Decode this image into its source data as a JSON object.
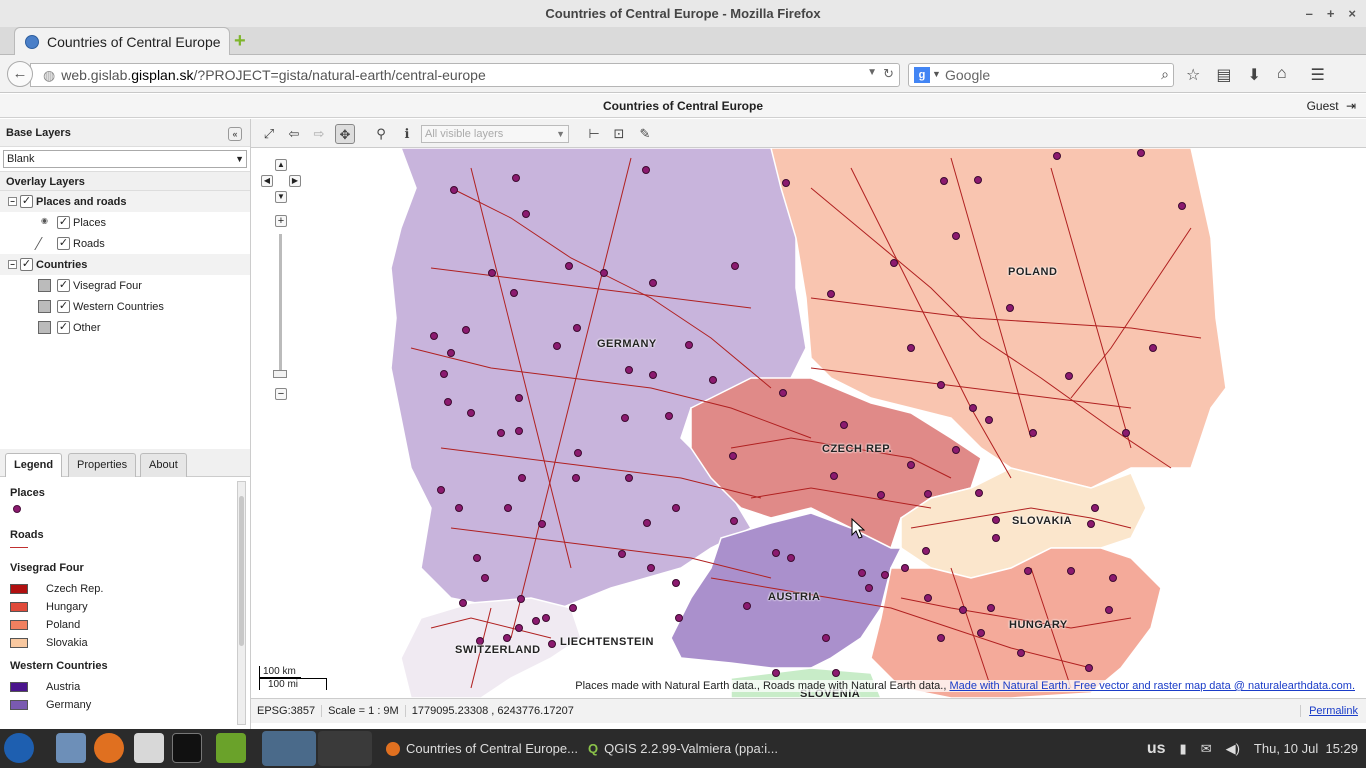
{
  "window": {
    "title": "Countries of Central Europe - Mozilla Firefox",
    "controls": [
      "–",
      "+",
      "×"
    ]
  },
  "tab": {
    "label": "Countries of Central Europe",
    "new_tab": "+"
  },
  "nav": {
    "url_prefix": "web.gislab.",
    "url_host": "gisplan.sk",
    "url_path": "/?PROJECT=gista/natural-earth/central-europe",
    "search_engine": "g",
    "search_placeholder": "Google"
  },
  "app": {
    "title": "Countries of Central Europe",
    "user": "Guest"
  },
  "left_panel": {
    "base_layers_title": "Base Layers",
    "base_layer_selected": "Blank",
    "overlay_title": "Overlay Layers",
    "groups": [
      {
        "label": "Places and roads",
        "children": [
          "Places",
          "Roads"
        ]
      },
      {
        "label": "Countries",
        "children": [
          "Visegrad Four",
          "Western Countries",
          "Other"
        ]
      }
    ]
  },
  "legend_tabs": [
    "Legend",
    "Properties",
    "About"
  ],
  "legend": {
    "places": "Places",
    "roads": "Roads",
    "visegrad_title": "Visegrad Four",
    "visegrad": [
      {
        "name": "Czech Rep.",
        "color": "#b01010"
      },
      {
        "name": "Hungary",
        "color": "#e04a3a"
      },
      {
        "name": "Poland",
        "color": "#f08060"
      },
      {
        "name": "Slovakia",
        "color": "#f8c8a0"
      }
    ],
    "western_title": "Western Countries",
    "western": [
      {
        "name": "Austria",
        "color": "#4a148c"
      },
      {
        "name": "Germany",
        "color": "#7a5ab0"
      }
    ]
  },
  "toolbar": {
    "layer_select": "All visible layers"
  },
  "map": {
    "labels": {
      "germany": "GERMANY",
      "poland": "POLAND",
      "czech": "CZECH REP.",
      "slovakia": "SLOVAKIA",
      "austria": "AUSTRIA",
      "hungary": "HUNGARY",
      "switzerland": "SWITZERLAND",
      "liechtenstein": "LIECHTENSTEIN",
      "slovenia": "SLOVENIA"
    },
    "scale_km": "100 km",
    "scale_mi": "100 mi",
    "attribution_plain": "Places made with Natural Earth data., Roads made with Natural Earth data.,",
    "attribution_link": "Made with Natural Earth. Free vector and raster map data @ naturalearthdata.com."
  },
  "status": {
    "crs": "EPSG:3857",
    "scale": "Scale = 1 : 9M",
    "coords": "1779095.23308 , 6243776.17207",
    "permalink": "Permalink"
  },
  "taskbar": {
    "tasks": [
      "Countries of Central Europe...",
      "QGIS 2.2.99-Valmiera (ppa:i..."
    ],
    "keyboard": "us",
    "clock": "Thu, 10 Jul  15:29"
  },
  "colors": {
    "germany_fill": "#c8b4dc",
    "poland_fill": "#f9c5b0",
    "czech_fill": "#e08a88",
    "slovakia_fill": "#fbe6cc",
    "austria_fill": "#aa90cc",
    "hungary_fill": "#f4aa9a",
    "switzerland_fill": "#f0eaf2",
    "slovenia_fill": "#c8ecc8",
    "road": "#b02020",
    "place": "#8b1a6f"
  }
}
